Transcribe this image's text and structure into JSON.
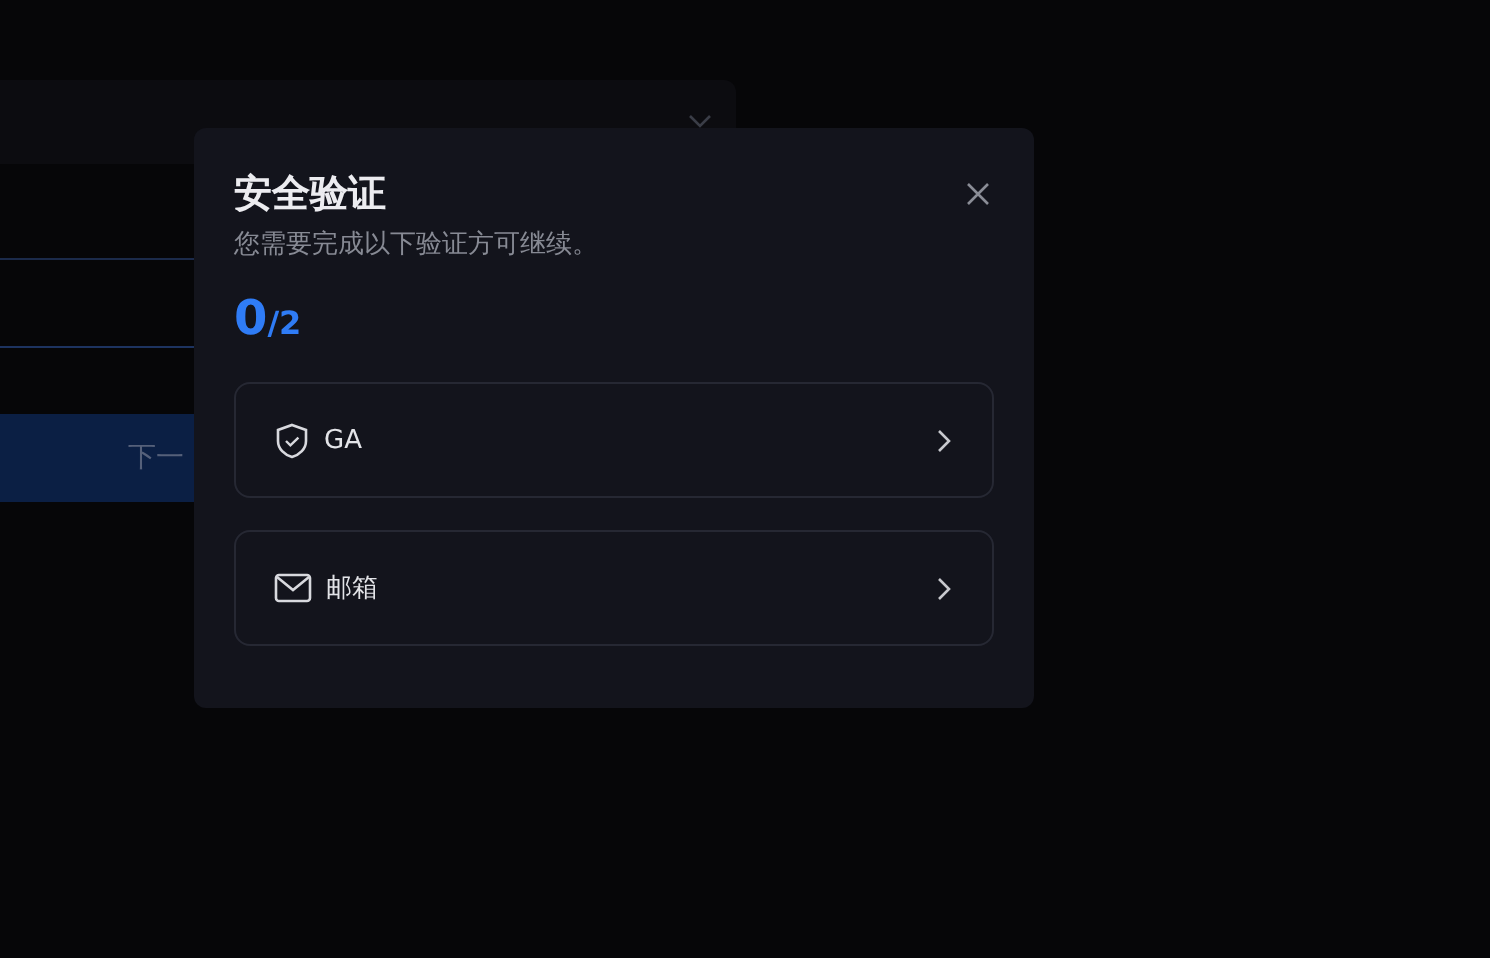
{
  "background_form": {
    "next_button": "下一"
  },
  "dialog": {
    "title": "安全验证",
    "subtitle": "您需要完成以下验证方可继续。",
    "progress": {
      "done": "0",
      "total": "/2"
    },
    "methods": [
      {
        "kind": "shield",
        "label": "GA"
      },
      {
        "kind": "mail",
        "label": "邮箱"
      }
    ]
  }
}
